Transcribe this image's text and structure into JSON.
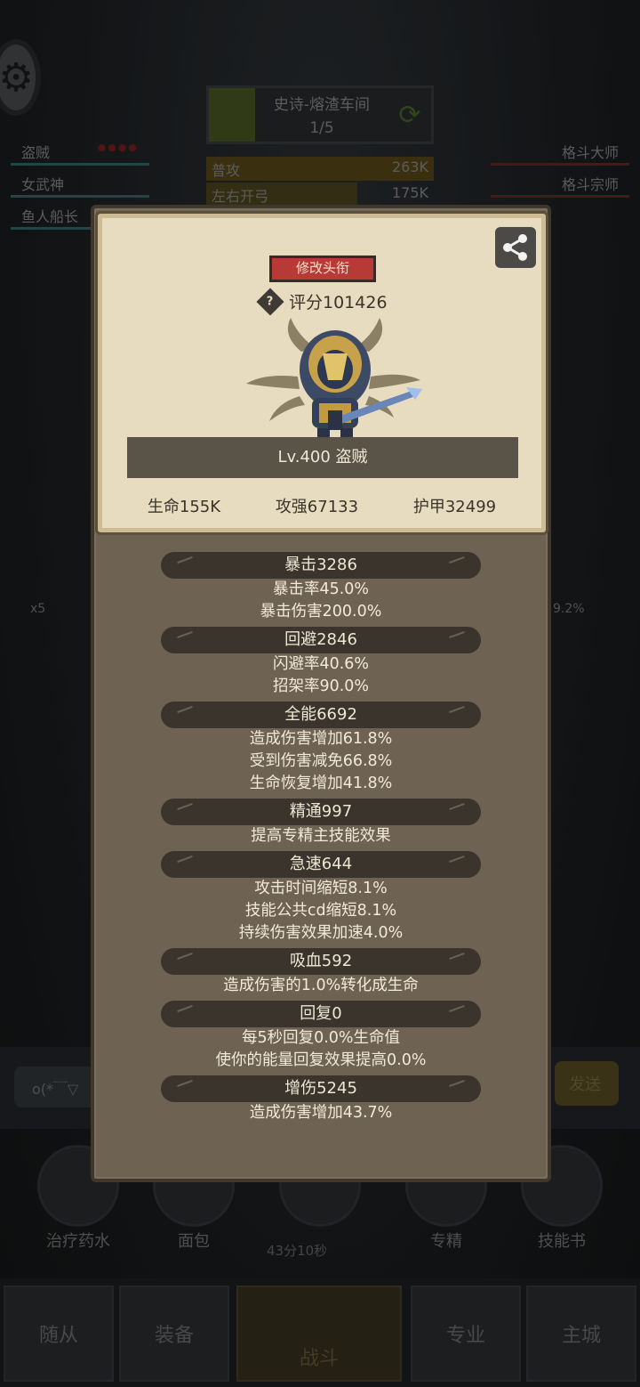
{
  "background": {
    "boss": {
      "name": "史诗-熔渣车间",
      "progress": "1/5"
    },
    "left_team": [
      "盗贼",
      "女武神",
      "鱼人船长"
    ],
    "right_team": [
      "格斗大师",
      "格斗宗师"
    ],
    "damage_rows": [
      {
        "label": "普攻",
        "value": "263K"
      },
      {
        "label": "左右开弓",
        "value": "175K"
      }
    ],
    "multiplier": "x5",
    "right_percent": "9.2%",
    "chat_placeholder": "o(*￣▽",
    "send_label": "发送",
    "quick_items": [
      "治疗药水",
      "面包",
      "",
      "专精",
      "技能书"
    ],
    "timer": "43分10秒",
    "nav": [
      "随从",
      "装备",
      "战斗",
      "专业",
      "主城"
    ]
  },
  "card": {
    "edit_title_label": "修改头衔",
    "score": "评分101426",
    "level_name": "Lv.400 盗贼",
    "stats": [
      "生命155K",
      "攻强67133",
      "护甲32499"
    ]
  },
  "attributes": [
    {
      "title": "暴击3286",
      "lines": [
        "暴击率45.0%",
        "暴击伤害200.0%"
      ]
    },
    {
      "title": "回避2846",
      "lines": [
        "闪避率40.6%",
        "招架率90.0%"
      ]
    },
    {
      "title": "全能6692",
      "lines": [
        "造成伤害增加61.8%",
        "受到伤害减免66.8%",
        "生命恢复增加41.8%"
      ]
    },
    {
      "title": "精通997",
      "lines": [
        "提高专精主技能效果"
      ]
    },
    {
      "title": "急速644",
      "lines": [
        "攻击时间缩短8.1%",
        "技能公共cd缩短8.1%",
        "持续伤害效果加速4.0%"
      ]
    },
    {
      "title": "吸血592",
      "lines": [
        "造成伤害的1.0%转化成生命"
      ]
    },
    {
      "title": "回复0",
      "lines": [
        "每5秒回复0.0%生命值",
        "使你的能量回复效果提高0.0%"
      ]
    },
    {
      "title": "增伤5245",
      "lines": [
        "造成伤害增加43.7%"
      ]
    }
  ]
}
